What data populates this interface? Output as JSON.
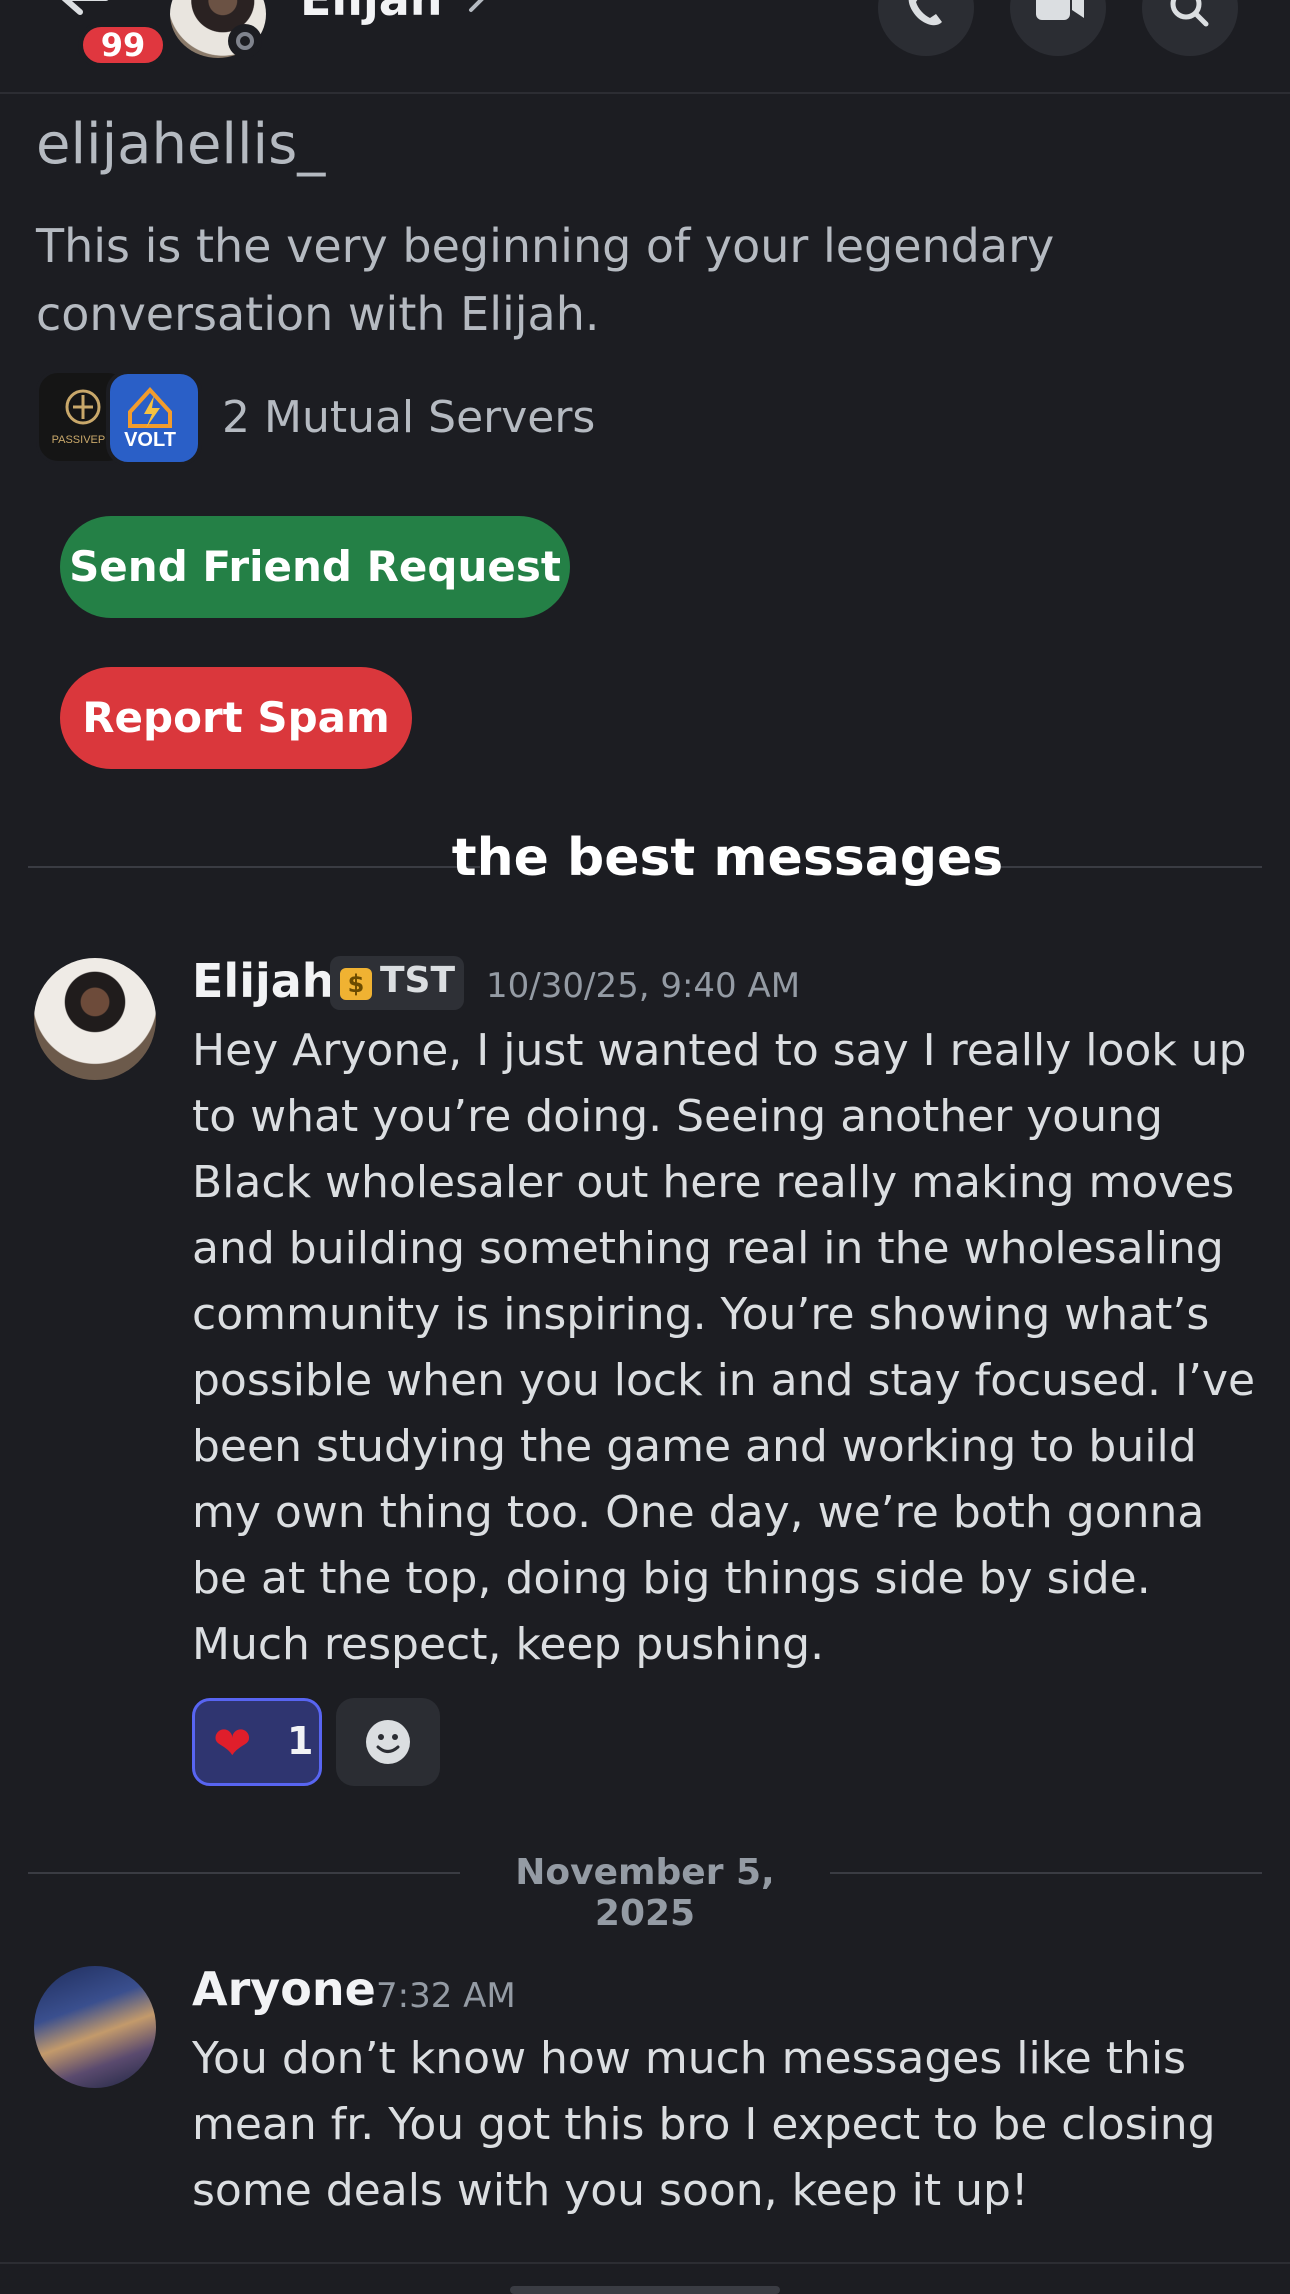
{
  "header": {
    "unread_count": "99",
    "name": "Elijah"
  },
  "intro": {
    "username": "elijahellis_",
    "text": "This is the very beginning of your legendary conversation with Elijah.",
    "mutual_servers": "2 Mutual Servers",
    "server_passive_label": "PASSIVEPIL",
    "server_volt_label": "VOLT",
    "send_friend_request": "Send Friend Request",
    "report_spam": "Report Spam"
  },
  "overlay_caption": "the best messages",
  "messages": [
    {
      "author": "Elijah",
      "tag": "TST",
      "timestamp": "10/30/25, 9:40 AM",
      "text": "Hey Aryone, I just wanted to say I really look up to what you’re doing. Seeing another young Black wholesaler out here really making moves and building something real in the wholesaling community is inspiring. You’re showing what’s possible when you lock in and stay focused. I’ve been studying the game and working to build my own thing too. One day, we’re both gonna be at the top, doing big things side by side. Much respect, keep pushing.",
      "reaction": {
        "emoji": "❤",
        "count": "1"
      }
    },
    {
      "author": "Aryone",
      "timestamp": "7:32 AM",
      "text": "You don’t know how much messages like this mean fr. You got this bro I expect to be closing some deals with you soon, keep it up!"
    }
  ],
  "date_divider": "November 5, 2025",
  "colors": {
    "background": "#1c1d22",
    "friend_button": "#248046",
    "spam_button": "#da373c",
    "unread_badge": "#e0373f",
    "reaction_bg": "#2f3570",
    "reaction_border": "#5865f2"
  },
  "icons": [
    "back-arrow-icon",
    "chevron-right-icon",
    "phone-icon",
    "video-icon",
    "search-icon",
    "smiley-icon",
    "heart-icon"
  ]
}
